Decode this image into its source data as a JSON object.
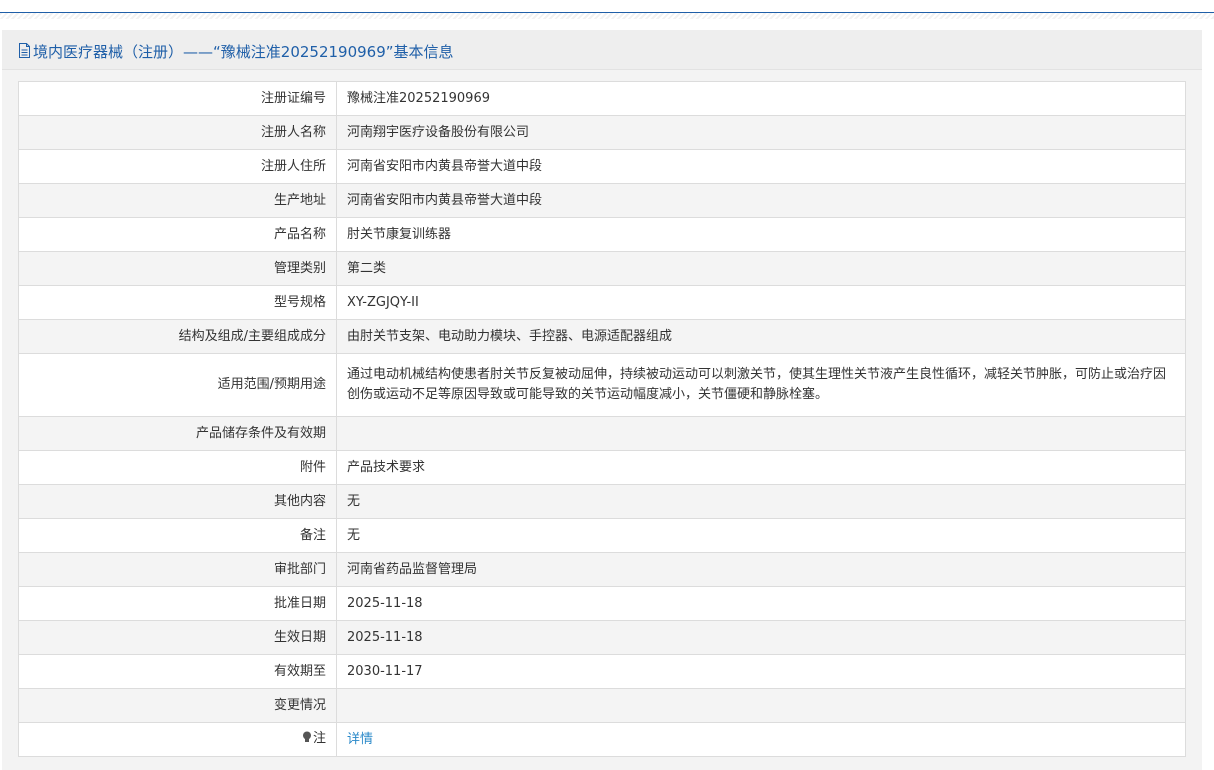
{
  "panel": {
    "icon": "document-icon",
    "title": "境内医疗器械（注册）——“豫械注准20252190969”基本信息"
  },
  "rows": [
    {
      "label": "注册证编号",
      "value": "豫械注准20252190969"
    },
    {
      "label": "注册人名称",
      "value": "河南翔宇医疗设备股份有限公司"
    },
    {
      "label": "注册人住所",
      "value": "河南省安阳市内黄县帝誉大道中段"
    },
    {
      "label": "生产地址",
      "value": "河南省安阳市内黄县帝誉大道中段"
    },
    {
      "label": "产品名称",
      "value": "肘关节康复训练器"
    },
    {
      "label": "管理类别",
      "value": "第二类"
    },
    {
      "label": "型号规格",
      "value": "XY-ZGJQY-II"
    },
    {
      "label": "结构及组成/主要组成成分",
      "value": "由肘关节支架、电动助力模块、手控器、电源适配器组成"
    },
    {
      "label": "适用范围/预期用途",
      "value": "通过电动机械结构使患者肘关节反复被动屈伸，持续被动运动可以刺激关节，使其生理性关节液产生良性循环，减轻关节肿胀，可防止或治疗因创伤或运动不足等原因导致或可能导致的关节运动幅度减小，关节僵硬和静脉栓塞。"
    },
    {
      "label": "产品储存条件及有效期",
      "value": ""
    },
    {
      "label": "附件",
      "value": "产品技术要求"
    },
    {
      "label": "其他内容",
      "value": "无"
    },
    {
      "label": "备注",
      "value": "无"
    },
    {
      "label": "审批部门",
      "value": "河南省药品监督管理局"
    },
    {
      "label": "批准日期",
      "value": "2025-11-18"
    },
    {
      "label": "生效日期",
      "value": "2025-11-18"
    },
    {
      "label": "有效期至",
      "value": "2030-11-17"
    },
    {
      "label": "变更情况",
      "value": ""
    }
  ],
  "note": {
    "icon": "lightbulb-icon",
    "label": "注",
    "link_text": "详情"
  },
  "colors": {
    "accent": "#1f5fa8",
    "link": "#2a89c9",
    "row_alt": "#f4f4f4",
    "border": "#dcdcdc"
  }
}
